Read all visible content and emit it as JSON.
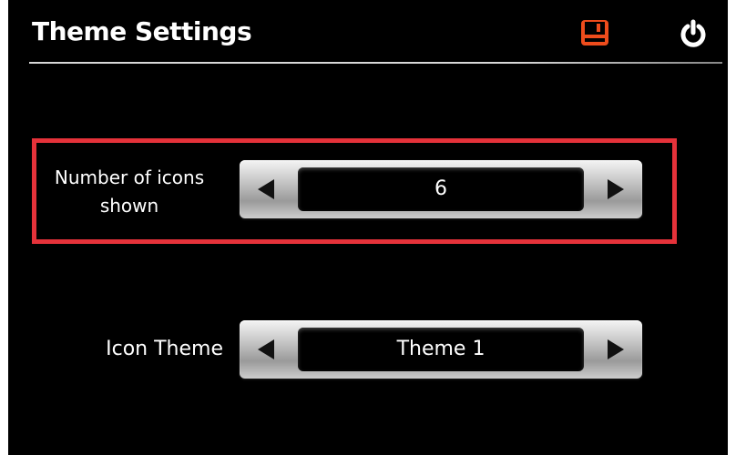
{
  "header": {
    "title": "Theme Settings",
    "save_icon": "save-icon",
    "power_icon": "power-icon"
  },
  "settings": [
    {
      "label": "Number of icons shown",
      "value": "6",
      "highlighted": true
    },
    {
      "label": "Icon Theme",
      "value": "Theme 1",
      "highlighted": false
    }
  ],
  "colors": {
    "background": "#000000",
    "text": "#ffffff",
    "highlight": "#e5323a",
    "save_icon": "#ee4c1c",
    "spinner_silver": "#c8c8c8"
  }
}
